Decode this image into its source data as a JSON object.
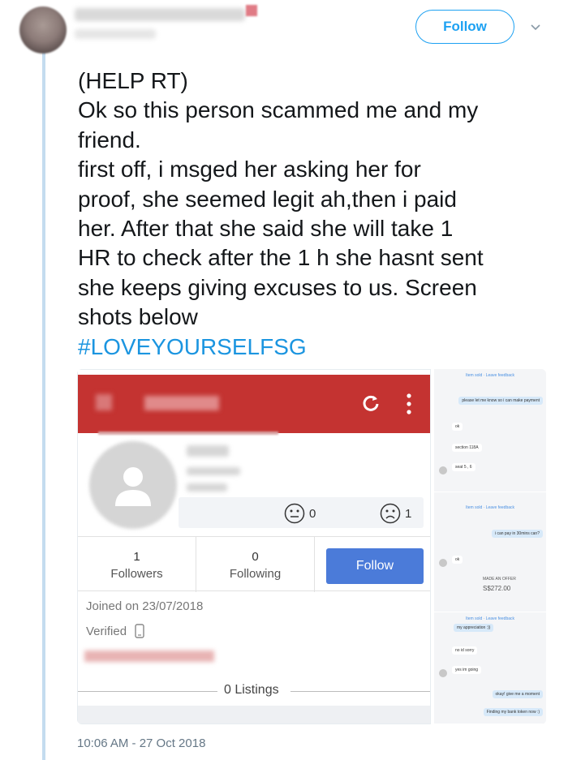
{
  "header": {
    "follow_label": "Follow"
  },
  "tweet": {
    "lines": [
      "(HELP RT)",
      "Ok so this person scammed me and my",
      "friend.",
      "first off, i msged her asking her for",
      "proof, she seemed legit ah,then i paid",
      "her. After that she said she will take 1",
      "HR to check after the 1 h she hasnt sent",
      "she keeps giving excuses to us. Screen",
      "shots below"
    ],
    "hashtag": "#LOVEYOURSELFSG",
    "timestamp": "10:06 AM - 27 Oct 2018"
  },
  "profile_screenshot": {
    "reactions": {
      "neutral_count": "0",
      "sad_count": "1"
    },
    "followers_count": "1",
    "followers_label": "Followers",
    "following_count": "0",
    "following_label": "Following",
    "follow_label": "Follow",
    "joined": "Joined on 23/07/2018",
    "verified": "Verified",
    "listings": "0 Listings",
    "colors": {
      "header_red": "#c43331",
      "follow_blue": "#4b7bd9"
    }
  },
  "chat_screenshots": [
    {
      "header": "Item sold · Leave feedback",
      "messages": [
        {
          "text": "please let me know so i can make payment",
          "from": "me"
        },
        {
          "text": "ok",
          "from": "them"
        },
        {
          "text": "section 118A",
          "from": "them"
        },
        {
          "text": "seat 5 , 6",
          "from": "them"
        }
      ]
    },
    {
      "header": "Item sold · Leave feedback",
      "messages": [
        {
          "text": "i can pay in 30mins can?",
          "from": "me"
        },
        {
          "text": "ok",
          "from": "them"
        }
      ],
      "offer_label": "MADE AN OFFER",
      "offer_value": "S$272.00"
    },
    {
      "header": "Item sold · Leave feedback",
      "messages": [
        {
          "text": "my appreciation :))",
          "from": "me"
        },
        {
          "text": "no id sorry",
          "from": "them"
        },
        {
          "text": "yes im going",
          "from": "them"
        },
        {
          "text": "okay! give me a moment",
          "from": "me"
        },
        {
          "text": "Finding my bank token now :)",
          "from": "me"
        }
      ]
    }
  ],
  "icons": {
    "chevron": "chevron-down-icon",
    "refresh": "refresh-icon",
    "more": "more-vertical-icon",
    "neutral": "neutral-face-icon",
    "sad": "sad-face-icon",
    "phone": "phone-icon"
  }
}
